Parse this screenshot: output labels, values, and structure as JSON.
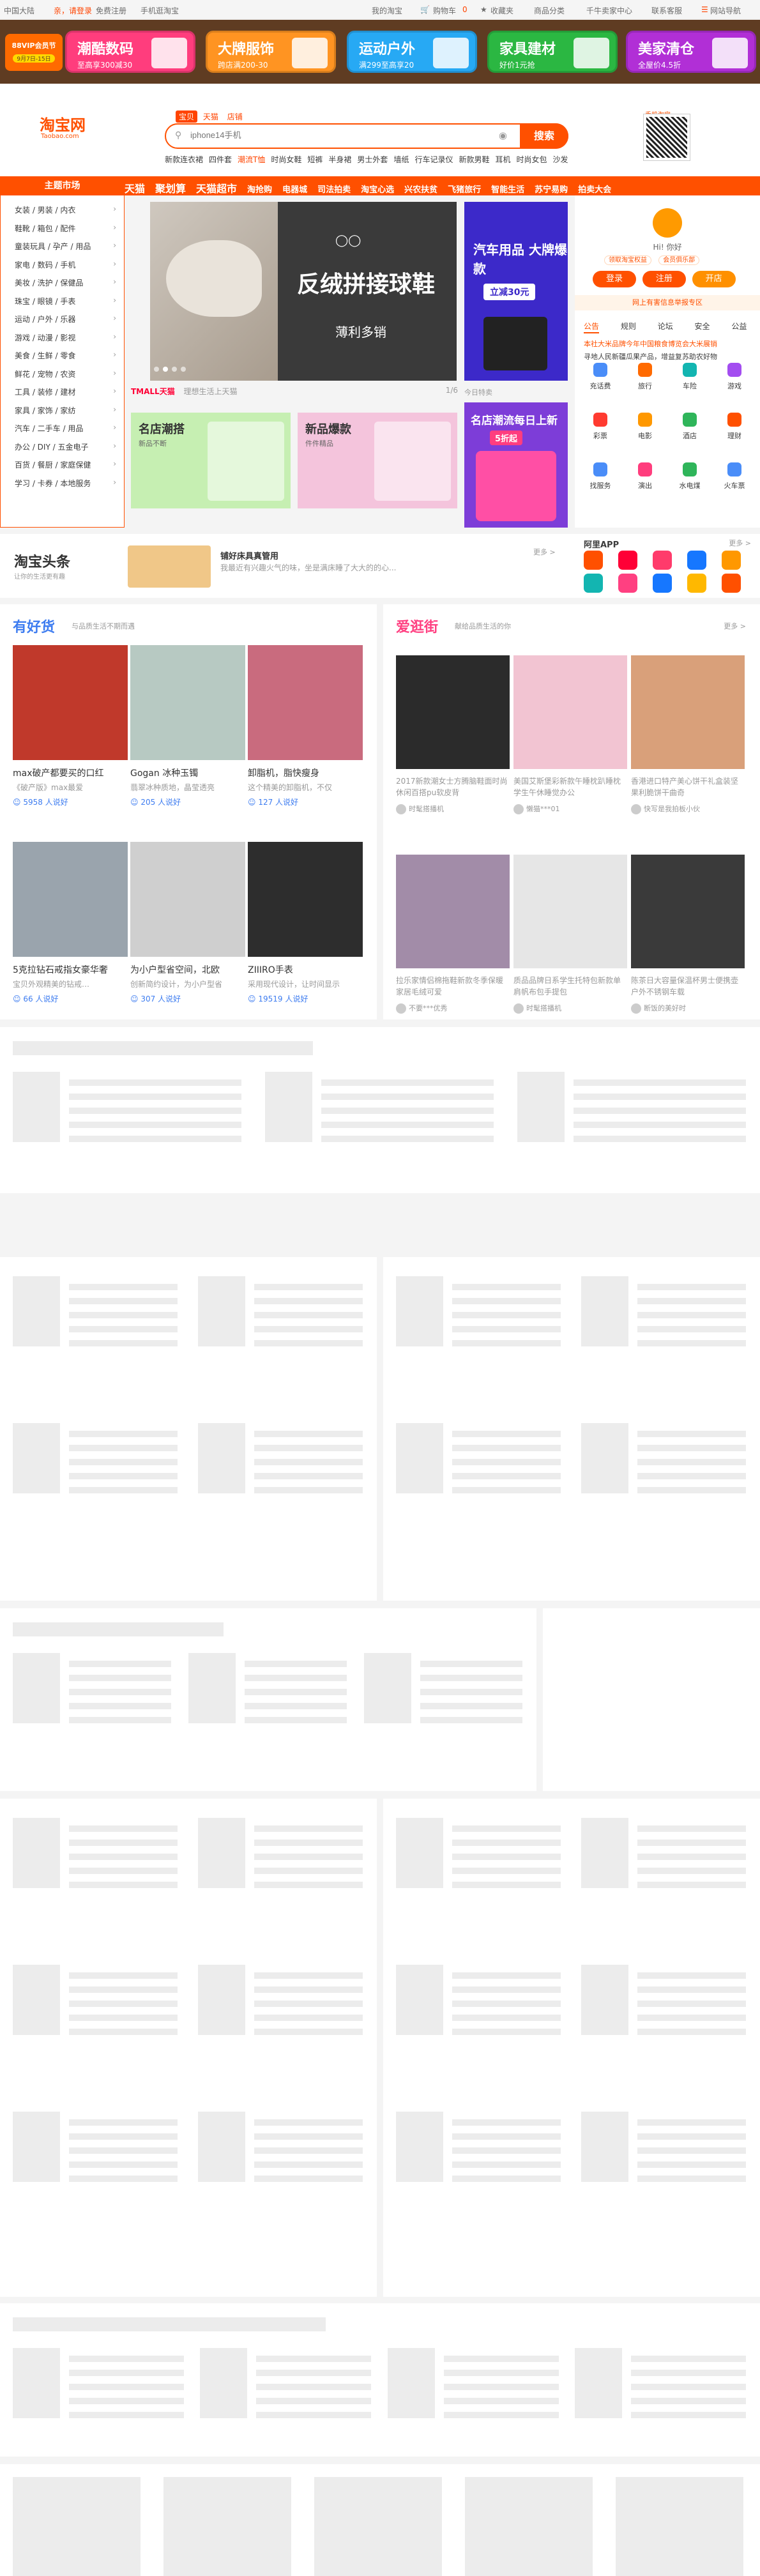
{
  "topbar": {
    "region": "中国大陆",
    "login": "亲，请登录",
    "register": "免费注册",
    "mobile": "手机逛淘宝",
    "my_taobao": "我的淘宝",
    "cart": "购物车",
    "cart_count": "0",
    "favorites": "收藏夹",
    "categories": "商品分类",
    "seller": "千牛卖家中心",
    "contact": "联系客服",
    "sitemap": "网站导航"
  },
  "promo": {
    "cards": [
      {
        "title": "潮酷数码",
        "sub": "至高享300减30",
        "color": "#ff3d7d"
      },
      {
        "title": "大牌服饰",
        "sub": "跨店满200-30",
        "color": "#ff9422"
      },
      {
        "title": "运动户外",
        "sub": "满299至高享20",
        "color": "#27a9f4"
      },
      {
        "title": "家具建材",
        "sub": "好价1元抢",
        "color": "#2bb742"
      },
      {
        "title": "美家清仓",
        "sub": "全屋价4.5折",
        "color": "#b12fd6"
      }
    ],
    "badge": "88VIP会员节",
    "badge_sub": "9月7日-15日"
  },
  "header": {
    "logo": "淘宝网",
    "logo_sub": "Taobao.com",
    "search_tabs": [
      "宝贝",
      "天猫",
      "店铺"
    ],
    "search_placeholder": "iphone14手机",
    "search_button": "搜索",
    "hot_words": [
      "新款连衣裙",
      "四件套",
      "潮流T恤",
      "时尚女鞋",
      "短裤",
      "半身裙",
      "男士外套",
      "墙纸",
      "行车记录仪",
      "新款男鞋",
      "耳机",
      "时尚女包",
      "沙发"
    ],
    "qr_label": "手机淘宝"
  },
  "nav": {
    "category_title": "主题市场",
    "items": [
      "天猫",
      "聚划算",
      "天猫超市",
      "淘抢购",
      "电器城",
      "司法拍卖",
      "淘宝心选",
      "兴农扶贫",
      "飞猪旅行",
      "智能生活",
      "苏宁易购",
      "拍卖大会"
    ]
  },
  "categories": [
    "女装 / 男装 / 内衣",
    "鞋靴 / 箱包 / 配件",
    "童装玩具 / 孕产 / 用品",
    "家电 / 数码 / 手机",
    "美妆 / 洗护 / 保健品",
    "珠宝 / 眼镜 / 手表",
    "运动 / 户外 / 乐器",
    "游戏 / 动漫 / 影视",
    "美食 / 生鲜 / 零食",
    "鲜花 / 宠物 / 农资",
    "工具 / 装修 / 建材",
    "家具 / 家饰 / 家纺",
    "汽车 / 二手车 / 用品",
    "办公 / DIY / 五金电子",
    "百货 / 餐厨 / 家庭保健",
    "学习 / 卡券 / 本地服务"
  ],
  "banner": {
    "title": "反绒拼接球鞋",
    "subtitle": "薄利多销"
  },
  "side_ad1": {
    "title": "汽车用品 大牌爆款",
    "button": "立减30元"
  },
  "tmall_row": {
    "logo": "TMALL天猫",
    "text": "理想生活上天猫",
    "page": "1/6"
  },
  "tmall_cards": [
    {
      "title": "名店潮搭",
      "sub": "新品不断"
    },
    {
      "title": "新品爆款",
      "sub": "件件精品"
    }
  ],
  "side_ad2": {
    "label": "今日特卖",
    "title": "名店潮流每日上新",
    "button": "5折起"
  },
  "user": {
    "greet": "Hi! 你好",
    "tags": [
      "领取淘宝权益",
      "会员俱乐部"
    ],
    "login": "登录",
    "register": "注册",
    "open_shop": "开店",
    "safe_tip": "网上有害信息举报专区",
    "tabs": [
      "公告",
      "规则",
      "论坛",
      "安全",
      "公益"
    ],
    "news": [
      "本社大米品牌今年中国粮食博览会大米展销",
      "寻地人民新疆瓜果产品，增益复苏助农好物"
    ],
    "services": [
      "充话费",
      "旅行",
      "车险",
      "游戏",
      "彩票",
      "电影",
      "酒店",
      "理财",
      "找服务",
      "演出",
      "水电煤",
      "火车票"
    ]
  },
  "headline": {
    "logo": "淘宝头条",
    "sub": "让你的生活更有趣",
    "title": "铺好床具真管用",
    "desc": "我最近有兴趣火气的味，坐是满床睡了大大的的心...",
    "more": "更多 >"
  },
  "apps": {
    "title": "阿里APP",
    "more": "更多 >"
  },
  "haohuo": {
    "title": "有好货",
    "sub": "与品质生活不期而遇",
    "items": [
      {
        "name": "max破产都要买的口红",
        "desc": "《破产版》max最爱",
        "likes": "5958 人说好"
      },
      {
        "name": "Gogan 冰种玉镯",
        "desc": "翡翠冰种质地，晶莹透亮",
        "likes": "205 人说好"
      },
      {
        "name": "卸脂机，脂快瘦身",
        "desc": "这个精美的卸脂机，不仅",
        "likes": "127 人说好"
      },
      {
        "name": "5克拉钻石戒指女豪华奢",
        "desc": "宝贝外观精美的钻戒…",
        "likes": "66 人说好"
      },
      {
        "name": "为小户型省空间，北欧",
        "desc": "创新简约设计，为小户型省",
        "likes": "307 人说好"
      },
      {
        "name": "ZIIIRO手表",
        "desc": "采用现代设计，让时间显示",
        "likes": "19519 人说好"
      }
    ]
  },
  "aiguangjie": {
    "title": "爱逛街",
    "sub": "献给品质生活的你",
    "more": "更多 >",
    "items": [
      {
        "desc": "2017新款潮女士方腾脑鞋面时尚休闲百搭pu软皮背",
        "user": "时髦搭播机"
      },
      {
        "desc": "美国艾斯堡彩新款午睡枕趴睡枕学生午休睡觉办公",
        "user": "懒猫***01"
      },
      {
        "desc": "香港进口特产美心饼干礼盒装坚果利脆饼干曲奇",
        "user": "快写是我拍板小伙"
      },
      {
        "desc": "拉乐家情侣棉拖鞋新款冬季保暖家居毛绒可爱",
        "user": "不要***优秀"
      },
      {
        "desc": "质品品牌日系学生托特包新款单肩帆布包手提包",
        "user": "时髦搭播机"
      },
      {
        "desc": "陈茶日大容量保温杯男士便携壶户外不锈钢车载",
        "user": "断饭的美好时"
      }
    ]
  },
  "colors": {
    "brand": "#ff5000",
    "promo_bg": "#5f3c22",
    "link": "#3d7cf0"
  }
}
